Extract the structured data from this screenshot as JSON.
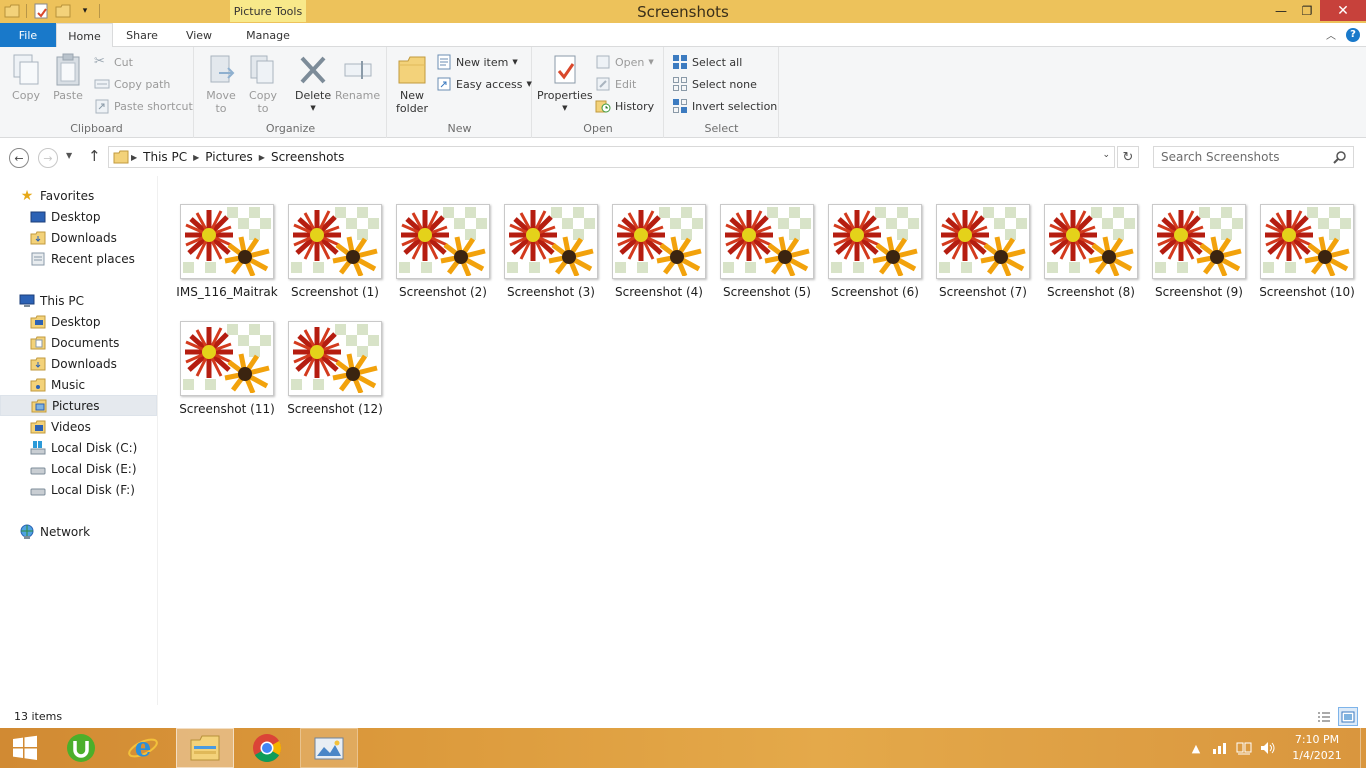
{
  "window": {
    "title": "Screenshots",
    "contextual_tab": "Picture Tools"
  },
  "ribbon_tabs": [
    "File",
    "Home",
    "Share",
    "View",
    "Manage"
  ],
  "ribbon": {
    "clipboard": {
      "label": "Clipboard",
      "copy": "Copy",
      "paste": "Paste",
      "cut": "Cut",
      "copy_path": "Copy path",
      "paste_shortcut": "Paste shortcut"
    },
    "organize": {
      "label": "Organize",
      "move_to": [
        "Move",
        "to"
      ],
      "copy_to": [
        "Copy",
        "to"
      ],
      "delete": "Delete",
      "rename": "Rename"
    },
    "new": {
      "label": "New",
      "new_folder": [
        "New",
        "folder"
      ],
      "new_item": "New item",
      "easy_access": "Easy access"
    },
    "open": {
      "label": "Open",
      "properties": "Properties",
      "open": "Open",
      "edit": "Edit",
      "history": "History"
    },
    "select": {
      "label": "Select",
      "select_all": "Select all",
      "select_none": "Select none",
      "invert_selection": "Invert selection"
    }
  },
  "address": {
    "crumbs": [
      "This PC",
      "Pictures",
      "Screenshots"
    ],
    "search_placeholder": "Search Screenshots"
  },
  "navpane": {
    "favorites": {
      "label": "Favorites",
      "items": [
        "Desktop",
        "Downloads",
        "Recent places"
      ]
    },
    "this_pc": {
      "label": "This PC",
      "items": [
        "Desktop",
        "Documents",
        "Downloads",
        "Music",
        "Pictures",
        "Videos",
        "Local Disk (C:)",
        "Local Disk (E:)",
        "Local Disk (F:)"
      ]
    },
    "network": {
      "label": "Network"
    },
    "selected": "Pictures"
  },
  "files": [
    "IMS_116_Maitrak",
    "Screenshot (1)",
    "Screenshot (2)",
    "Screenshot (3)",
    "Screenshot (4)",
    "Screenshot (5)",
    "Screenshot (6)",
    "Screenshot (7)",
    "Screenshot (8)",
    "Screenshot (9)",
    "Screenshot (10)",
    "Screenshot (11)",
    "Screenshot (12)"
  ],
  "status": {
    "item_count": "13 items"
  },
  "taskbar": {
    "apps": [
      "start-icon",
      "utorrent-icon",
      "internet-explorer-icon",
      "file-explorer-icon",
      "chrome-icon",
      "photo-app-icon"
    ],
    "time": "7:10 PM",
    "date": "1/4/2021"
  },
  "colors": {
    "titlebar": "#edc25b",
    "file_tab": "#1979ca",
    "close_button": "#c7413b",
    "taskbar": "#dc9a3c",
    "selection": "#e5e9ee"
  }
}
